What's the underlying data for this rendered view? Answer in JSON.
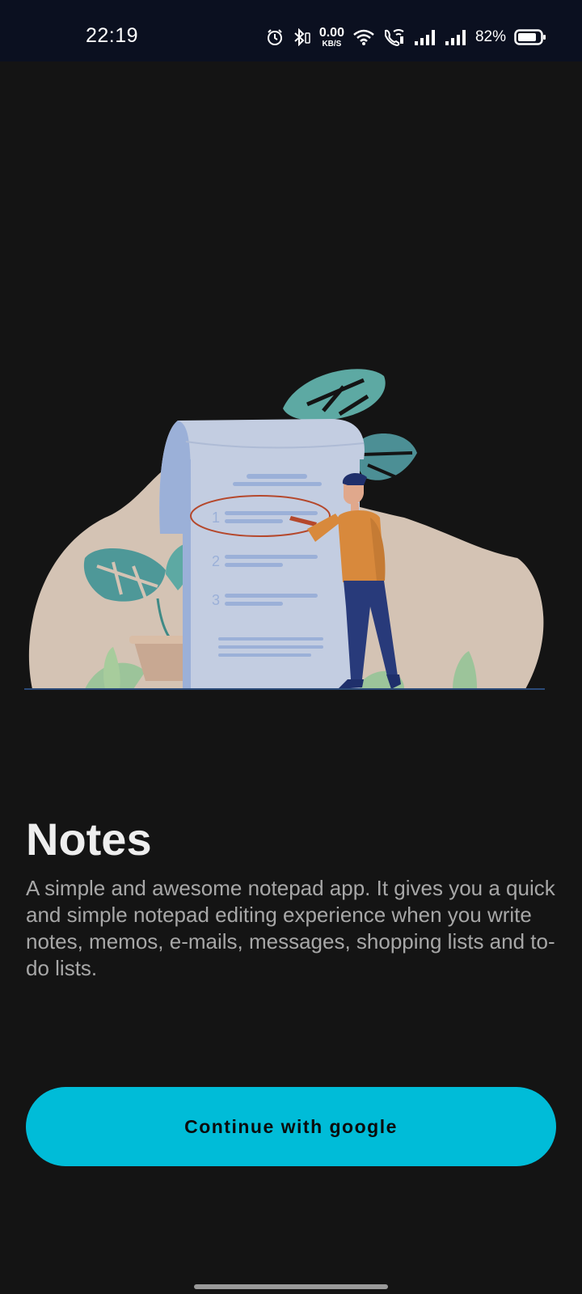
{
  "status_bar": {
    "time": "22:19",
    "net_speed_value": "0.00",
    "net_speed_unit": "KB/S",
    "battery_percent": "82%",
    "icons": [
      "alarm-icon",
      "bluetooth-icon",
      "wifi-icon",
      "wifi-calling-icon",
      "signal-icon",
      "signal-icon",
      "battery-icon"
    ]
  },
  "illustration": {
    "list_numbers": [
      "1",
      "2",
      "3"
    ],
    "colors": {
      "blob": "#d4c3b4",
      "paper": "#c3cde1",
      "paper_curl": "#9bb0d8",
      "lines": "#9bb0d8",
      "circle_mark": "#b5482c",
      "person_shirt": "#d8893c",
      "person_pants": "#283a7a",
      "leaf": "#5da9a3",
      "plant_light": "#9cc49a"
    }
  },
  "onboarding": {
    "title": "Notes",
    "description": "A simple and awesome notepad app. It gives you a quick and simple notepad editing experience when you write notes, memos, e-mails, messages, shopping lists and to-do lists.",
    "cta_label": "Continue with google"
  },
  "colors": {
    "background": "#141414",
    "status_bar": "#0b1020",
    "accent": "#00bcd8"
  }
}
